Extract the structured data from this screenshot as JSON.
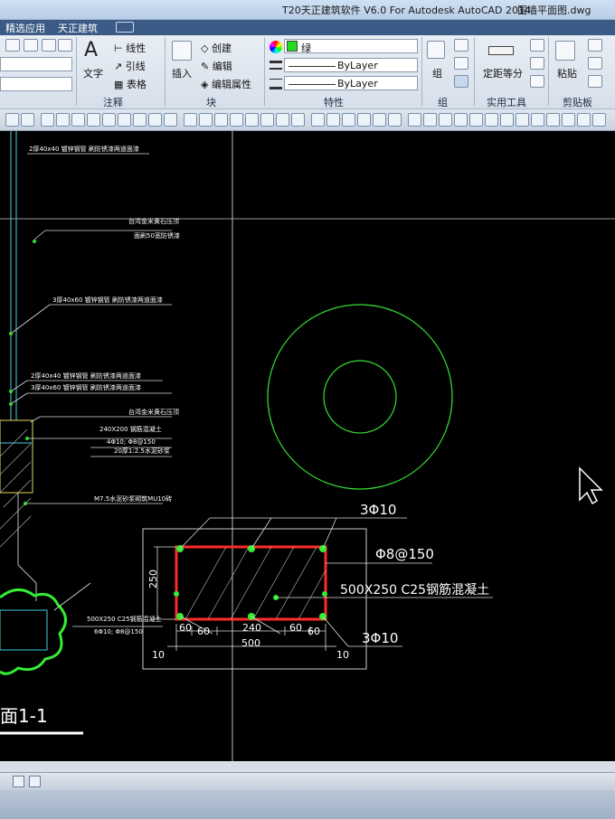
{
  "window": {
    "title": "T20天正建筑软件 V6.0 For Autodesk AutoCAD 2014",
    "filename": "围墙平面图.dwg"
  },
  "tabs": [
    "精选应用",
    "天正建筑"
  ],
  "ribbon": {
    "annotation": {
      "text_label": "文字",
      "linear": "线性",
      "leader": "引线",
      "table": "表格",
      "group_label": "注释"
    },
    "block": {
      "insert": "插入",
      "create": "创建",
      "edit": "编辑",
      "edit_attr": "编辑属性",
      "group_label": "块"
    },
    "properties": {
      "color_value": "绿",
      "linetype": "ByLayer",
      "lineweight": "ByLayer",
      "group_label": "特性",
      "swatch_color": "#22dd22"
    },
    "group": {
      "group_label": "组",
      "group_button": "组"
    },
    "utilities": {
      "measure": "定距等分",
      "group_label": "实用工具"
    },
    "clipboard": {
      "paste": "粘贴",
      "group_label": "剪贴板"
    }
  },
  "drawing": {
    "notes_left": [
      "2厚40x40 镀锌钢管 刷防锈漆两道面漆",
      "台湾金米黄石压顶",
      "面刷50宽防锈漆",
      "3厚40x60 镀锌钢管 刷防锈漆两道面漆",
      "2厚40x40 镀锌钢管 刷防锈漆两道面漆",
      "3厚40x60 镀锌钢管 刷防锈漆两道面漆",
      "台湾金米黄石压顶",
      "240X200 钢筋混凝土",
      "4Φ10; Φ8@150",
      "20厚1:2.5水泥砂浆",
      "M7.5水泥砂浆砌筑MU10砖",
      "500X250 C25钢筋混凝土",
      "6Φ10; Φ8@150"
    ],
    "section_title": "面1-1",
    "detail": {
      "top_rebar": "3Φ10",
      "stirrup": "Φ8@150",
      "beam_spec": "500X250 C25钢筋混凝土",
      "bottom_rebar": "3Φ10",
      "height_dim": "250",
      "dims_bottom": [
        "60",
        "60",
        "240",
        "60",
        "60"
      ],
      "total_width": "500",
      "side_left": "10",
      "side_right": "10"
    }
  },
  "colors": {
    "cad_green": "#33dd33",
    "cad_red": "#ff2a2a",
    "cad_white": "#ffffff",
    "cad_cyan": "#44ccdd"
  }
}
